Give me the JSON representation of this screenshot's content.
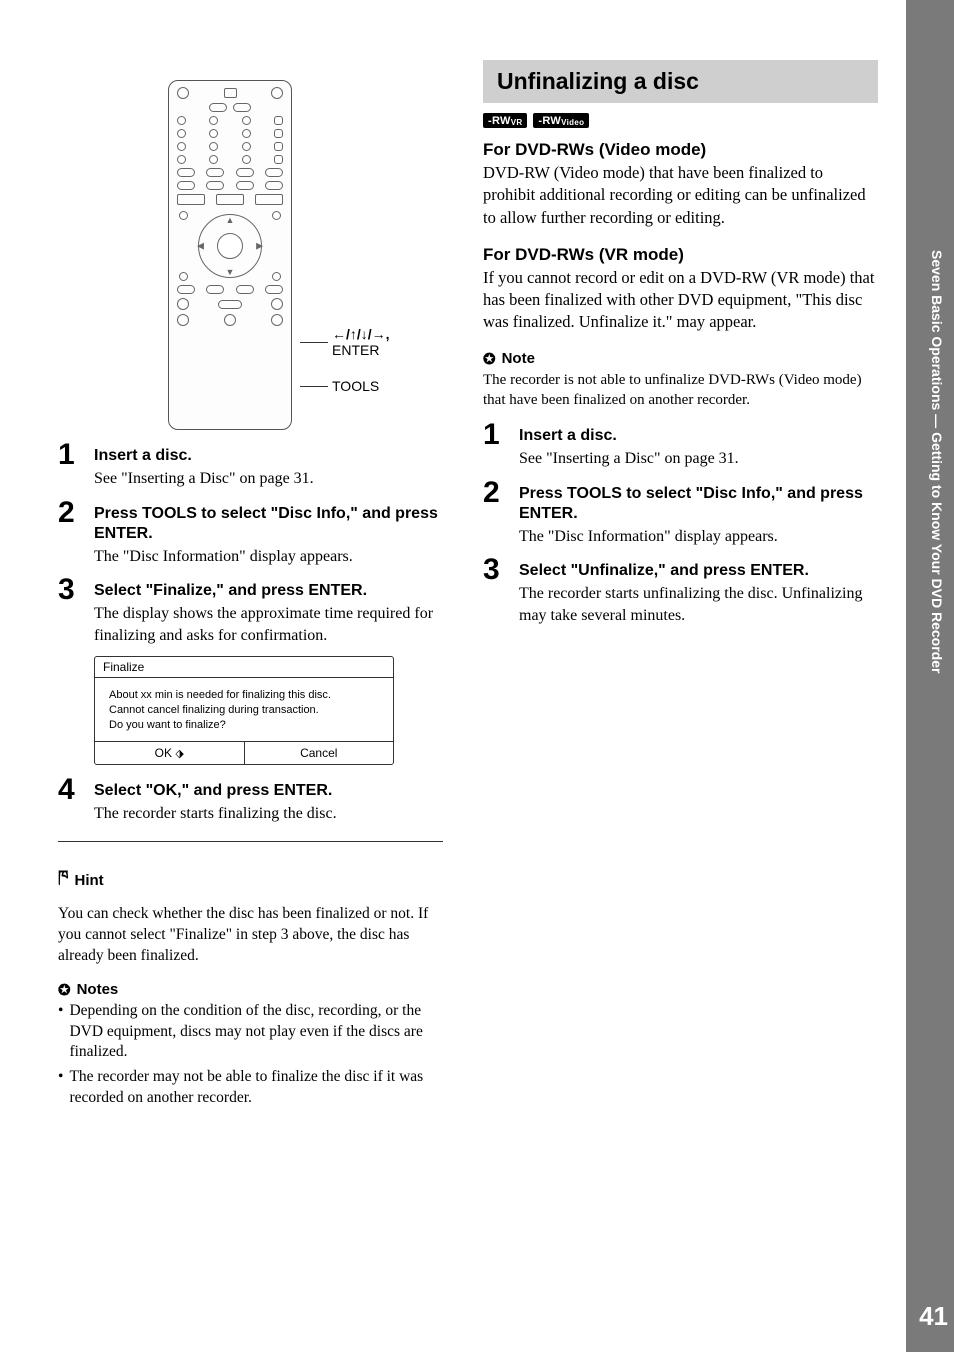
{
  "sideTab": {
    "label": "Seven Basic Operations — Getting to Know Your DVD Recorder",
    "pageNumber": "41"
  },
  "remoteLabels": {
    "arrows": "←/↑/↓/→,",
    "enter": "ENTER",
    "tools": "TOOLS"
  },
  "leftSteps": [
    {
      "num": "1",
      "head": "Insert a disc.",
      "text": "See \"Inserting a Disc\" on page 31."
    },
    {
      "num": "2",
      "head": "Press TOOLS to select \"Disc Info,\" and press ENTER.",
      "text": "The \"Disc Information\" display appears."
    },
    {
      "num": "3",
      "head": "Select \"Finalize,\" and press ENTER.",
      "text": "The display shows the approximate time required for finalizing and asks for confirmation."
    }
  ],
  "dialog": {
    "title": "Finalize",
    "line1": "About xx min is needed for finalizing this disc.",
    "line2": "Cannot cancel finalizing during transaction.",
    "line3": "Do you want to finalize?",
    "ok": "OK",
    "cancel": "Cancel"
  },
  "leftStep4": {
    "num": "4",
    "head": "Select \"OK,\" and press ENTER.",
    "text": "The recorder starts finalizing the disc."
  },
  "hint": {
    "label": "Hint",
    "text": "You can check whether the disc has been finalized or not. If you cannot select \"Finalize\" in step 3 above, the disc has already been finalized."
  },
  "notes": {
    "label": "Notes",
    "items": [
      "Depending on the condition of the disc, recording, or the DVD equipment, discs may not play even if the discs are finalized.",
      "The recorder may not be able to finalize the disc if it was recorded on another recorder."
    ]
  },
  "right": {
    "sectionTitle": "Unfinalizing a disc",
    "badges": [
      "-RWVR",
      "-RWVideo"
    ],
    "sub1": {
      "head": "For DVD-RWs (Video mode)",
      "text": "DVD-RW (Video mode) that have been finalized to prohibit additional recording or editing can be unfinalized to allow further recording or editing."
    },
    "sub2": {
      "head": "For DVD-RWs (VR mode)",
      "text": "If you cannot record or edit on a DVD-RW (VR mode) that has been finalized with other DVD equipment, \"This disc was finalized. Unfinalize it.\" may appear."
    },
    "note": {
      "label": "Note",
      "text": "The recorder is not able to unfinalize DVD-RWs (Video mode) that have been finalized on another recorder."
    },
    "steps": [
      {
        "num": "1",
        "head": "Insert a disc.",
        "text": "See \"Inserting a Disc\" on page 31."
      },
      {
        "num": "2",
        "head": "Press TOOLS to select \"Disc Info,\" and press ENTER.",
        "text": "The \"Disc Information\" display appears."
      },
      {
        "num": "3",
        "head": "Select \"Unfinalize,\" and press ENTER.",
        "text": "The recorder starts unfinalizing the disc. Unfinalizing may take several minutes."
      }
    ]
  }
}
